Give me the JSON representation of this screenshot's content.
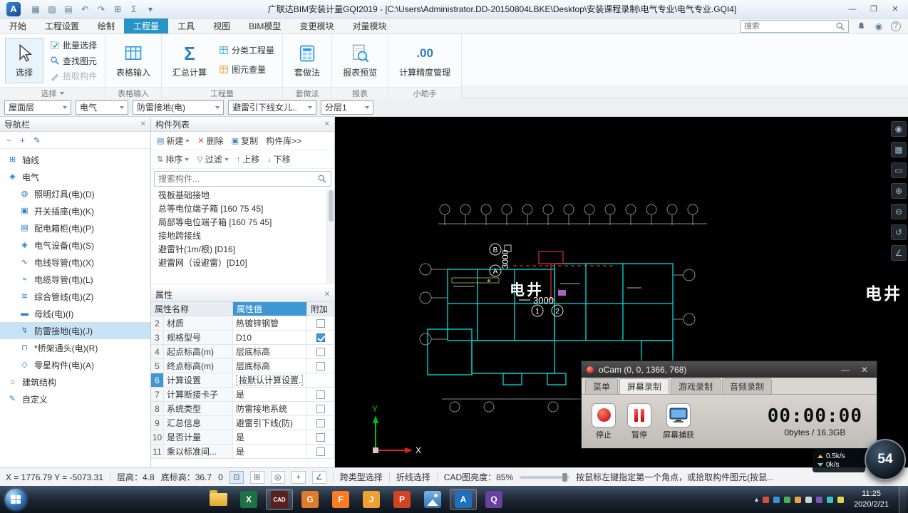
{
  "colors": {
    "accent_blue": "#2695c6",
    "grid_header_blue": "#3f97d1",
    "nav_selected": "#c8e2f6",
    "cad_cyan": "#00dede",
    "selection_red": "#ff4040",
    "record_red": "#c60d0d"
  },
  "ui": {
    "close": "✕"
  },
  "titlebar": {
    "logo": "A",
    "title": "广联达BIM安装计量GQI2019 - [C:\\Users\\Administrator.DD-20150804LBKE\\Desktop\\安装课程录制\\电气专业\\电气专业.GQI4]",
    "minimize": "—",
    "maximize": "❐",
    "close": "✕"
  },
  "menubar": {
    "tabs": [
      {
        "label": "开始"
      },
      {
        "label": "工程设置"
      },
      {
        "label": "绘制"
      },
      {
        "label": "工程量"
      },
      {
        "label": "工具"
      },
      {
        "label": "视图"
      },
      {
        "label": "BIM模型"
      },
      {
        "label": "变更模块"
      },
      {
        "label": "对量模块"
      }
    ],
    "search_placeholder": "搜索",
    "help": "?"
  },
  "ribbon": {
    "select": "选择",
    "batch_select": "批量选择",
    "find_element": "查找图元",
    "pick_component": "拾取构件",
    "table_input": "表格输入",
    "summary_calc": "汇总计算",
    "sigma": "Σ",
    "category_quantity": "分类工程量",
    "element_quantity": "图元查量",
    "apply_method": "套做法",
    "report_preview": "报表预览",
    "precision_manage": "计算精度管理",
    "precision_icon": ".00",
    "groups": {
      "select": "选择",
      "table_input": "表格输入",
      "quantity": "工程量",
      "method": "套做法",
      "report": "报表",
      "assistant": "小助手"
    }
  },
  "filters": {
    "floor": "屋面层",
    "major": "电气",
    "category": "防雷接地(电)",
    "component": "避雷引下线女儿..",
    "layer": "分层1"
  },
  "navigator": {
    "title": "导航栏",
    "tools": [
      "−",
      "+",
      "✎"
    ],
    "section_axis": "轴线",
    "section_axis_icon": "⊞",
    "section_electrical": "电气",
    "section_electrical_icon": "◈",
    "items": [
      {
        "icon": "◍",
        "label": "照明灯具(电)(D)"
      },
      {
        "icon": "▣",
        "label": "开关插座(电)(K)"
      },
      {
        "icon": "▤",
        "label": "配电箱柜(电)(P)"
      },
      {
        "icon": "◈",
        "label": "电气设备(电)(S)"
      },
      {
        "icon": "∿",
        "label": "电线导管(电)(X)"
      },
      {
        "icon": "≈",
        "label": "电缆导管(电)(L)"
      },
      {
        "icon": "≋",
        "label": "综合管线(电)(Z)"
      },
      {
        "icon": "▬",
        "label": "母线(电)(I)"
      },
      {
        "icon": "↯",
        "label": "防雷接地(电)(J)"
      },
      {
        "icon": "⊓",
        "label": "*桥架通头(电)(R)"
      },
      {
        "icon": "◇",
        "label": "零星构件(电)(A)"
      }
    ],
    "section_structure": "建筑结构",
    "section_structure_icon": "⌂",
    "section_custom": "自定义",
    "section_custom_icon": "✎"
  },
  "components": {
    "title": "构件列表",
    "icons": {
      "new": "▤",
      "delete": "✕",
      "copy": "▣",
      "sort": "⇅",
      "filter": "▽",
      "up": "↑",
      "down": "↓"
    },
    "new": "新建",
    "delete": "删除",
    "copy": "复制",
    "library": "构件库>>",
    "sort": "排序",
    "filter": "过滤",
    "move_up": "上移",
    "move_down": "下移",
    "search_placeholder": "搜索构件...",
    "items": [
      {
        "label": "筏板基础接地"
      },
      {
        "label": "总等电位端子箱 [160 75 45]"
      },
      {
        "label": "局部等电位端子箱 [160 75 45]"
      },
      {
        "label": "接地跨接线"
      },
      {
        "label": "避雷针(1m/根) [D16]"
      },
      {
        "label": "避雷网（设避雷）[D10]"
      }
    ]
  },
  "properties": {
    "title": "属性",
    "col_name": "属性名称",
    "col_value": "属性值",
    "col_attach": "附加",
    "rows": [
      {
        "no": "2",
        "name": "材质",
        "value": "热镀锌钢管",
        "cb": "empty"
      },
      {
        "no": "3",
        "name": "规格型号",
        "value": "D10",
        "cb": "checked"
      },
      {
        "no": "4",
        "name": "起点标高(m)",
        "value": "层底标高",
        "cb": "empty"
      },
      {
        "no": "5",
        "name": "终点标高(m)",
        "value": "层底标高",
        "cb": "empty"
      },
      {
        "no": "6",
        "name": "计算设置",
        "value": "按默认计算设置...",
        "cb": "none"
      },
      {
        "no": "7",
        "name": "计算断接卡子",
        "value": "是",
        "cb": "empty"
      },
      {
        "no": "8",
        "name": "系统类型",
        "value": "防雷接地系统",
        "cb": "empty"
      },
      {
        "no": "9",
        "name": "汇总信息",
        "value": "避雷引下线(防)",
        "cb": "empty"
      },
      {
        "no": "10",
        "name": "是否计量",
        "value": "是",
        "cb": "empty"
      },
      {
        "no": "11",
        "name": "乘以标准间...",
        "value": "是",
        "cb": "empty"
      }
    ]
  },
  "cad": {
    "tools": [
      "◉",
      "▦",
      "▭",
      "⊕",
      "⊖",
      "↺",
      "∠"
    ],
    "shaft_label": "电井",
    "shaft_label_right": "电井",
    "dim_vertical": "3000",
    "dim_horizontal": "3000",
    "bubble_a": "A",
    "bubble_b": "B",
    "bubble_1": "1",
    "bubble_2": "2",
    "axis_x": "X",
    "axis_y": "Y"
  },
  "ocam": {
    "title": "oCam (0, 0, 1366, 768)",
    "minimize": "—",
    "close": "✕",
    "tabs": [
      {
        "label": "菜单"
      },
      {
        "label": "屏幕录制"
      },
      {
        "label": "游戏录制"
      },
      {
        "label": "音频录制"
      }
    ],
    "stop": "停止",
    "pause": "暂停",
    "capture": "屏幕捕获",
    "timer": "00:00:00",
    "usage": "0bytes / 16.3GB"
  },
  "statusbar": {
    "coords": "X = 1776.79 Y = -5073.31",
    "floor_height": "层高：4.8",
    "floor_elevation": "底标高：36.7",
    "angle": "0",
    "tools": [
      "⊡",
      "⊞",
      "◎",
      "+",
      "∠"
    ],
    "cross_type_select": "跨类型选择",
    "polyline_select": "折线选择",
    "brightness": "CAD图亮度：85%",
    "hint": "按鼠标左键指定第一个角点，或拾取构件图元(按鼠..."
  },
  "taskbar": {
    "time": "11:25",
    "date": "2020/2/21",
    "tray_expand": "▴",
    "icons": [
      {
        "name": "explorer-folder",
        "glyph": "",
        "color": ""
      },
      {
        "name": "excel",
        "glyph": "X",
        "color": "#1e7145"
      },
      {
        "name": "autocad",
        "glyph": "CAD",
        "color": "#5a1f1f"
      },
      {
        "name": "glodon-app",
        "glyph": "G",
        "color": "#e07b2a"
      },
      {
        "name": "foxit-pdf",
        "glyph": "F",
        "color": "#fb7b22"
      },
      {
        "name": "app-orange",
        "glyph": "J",
        "color": "#f0a030"
      },
      {
        "name": "powerpoint",
        "glyph": "P",
        "color": "#d04423"
      },
      {
        "name": "photo-viewer",
        "glyph": "",
        "color": ""
      },
      {
        "name": "gqi2019",
        "glyph": "A",
        "color": "#1f6fc0"
      },
      {
        "name": "app-purple",
        "glyph": "Q",
        "color": "#6a3fa0"
      }
    ]
  },
  "netmeter": {
    "up": "0.5k/s",
    "down": "0k/s",
    "ball": "54"
  }
}
